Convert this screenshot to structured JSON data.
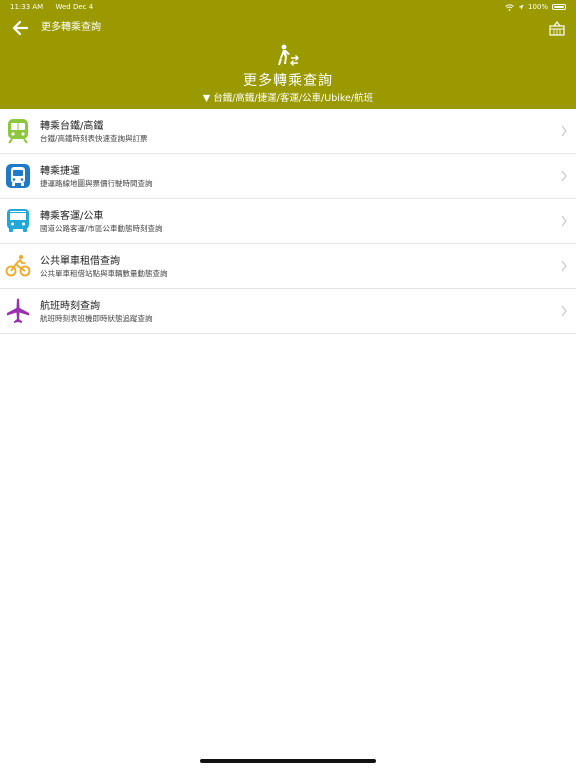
{
  "status": {
    "time": "11:33 AM",
    "date": "Wed Dec 4",
    "battery": "100%",
    "icons": [
      "wifi-icon",
      "location-icon",
      "battery-icon"
    ]
  },
  "nav": {
    "title": "更多轉乘查詢",
    "back_icon": "arrow-left-icon",
    "right_icon": "basket-icon"
  },
  "hero": {
    "icon": "walking-transfer-icon",
    "title": "更多轉乘查詢",
    "subtitle": "▼ 台鐵/高鐵/捷運/客運/公車/Ubike/航班"
  },
  "items": [
    {
      "title": "轉乘台鐵/高鐵",
      "desc": "台鐵/高鐵時刻表快速查詢與訂票",
      "icon": "train-icon",
      "color": "#8dc63f"
    },
    {
      "title": "轉乘捷運",
      "desc": "捷運路線地圖與票價行駛時間查詢",
      "icon": "metro-icon",
      "color": "#1f78c8"
    },
    {
      "title": "轉乘客運/公車",
      "desc": "國道公路客運/市區公車動態時刻查詢",
      "icon": "bus-icon",
      "color": "#22a8d8"
    },
    {
      "title": "公共單車租借查詢",
      "desc": "公共單車租借站點與車輛數量動態查詢",
      "icon": "bicycle-icon",
      "color": "#f5a623"
    },
    {
      "title": "航班時刻查詢",
      "desc": "航班時刻表班機即時狀態追蹤查詢",
      "icon": "airplane-icon",
      "color": "#9b2fae"
    }
  ],
  "colors": {
    "header_bg": "#9a9a00",
    "divider": "#e5e5e5",
    "chevron": "#c8c8c8"
  }
}
